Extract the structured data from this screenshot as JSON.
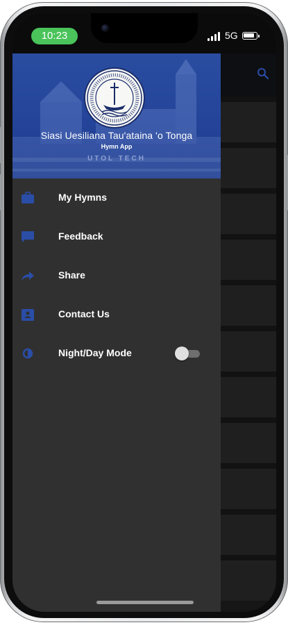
{
  "status_bar": {
    "time": "10:23",
    "network": "5G"
  },
  "drawer": {
    "header": {
      "org_name": "Siasi Uesiliana Tau'ataina 'o Tonga",
      "app_name": "Hymn App",
      "developer": "UTOL TECH"
    },
    "menu": [
      {
        "label": "My Hymns",
        "icon": "briefcase-icon"
      },
      {
        "label": "Feedback",
        "icon": "message-icon"
      },
      {
        "label": "Share",
        "icon": "share-icon"
      },
      {
        "label": "Contact Us",
        "icon": "contact-card-icon"
      },
      {
        "label": "Night/Day Mode",
        "icon": "brightness-icon",
        "toggle": false
      }
    ]
  },
  "colors": {
    "header_blue": "#24449a",
    "drawer_bg": "#303030",
    "icon_blue": "#2a4da6",
    "status_green": "#49c35a"
  }
}
